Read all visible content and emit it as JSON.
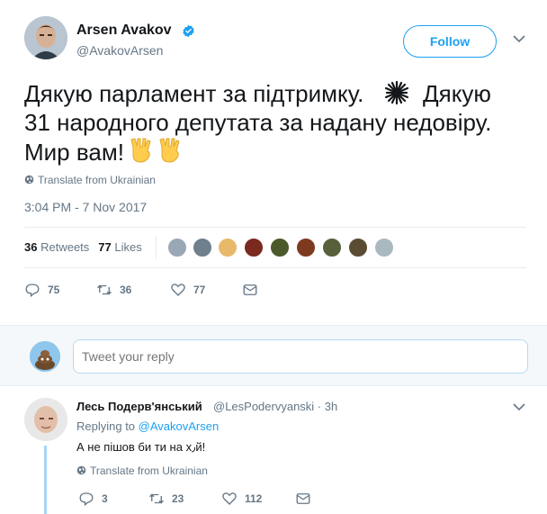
{
  "author": {
    "name": "Arsen Avakov",
    "handle": "@AvakovArsen",
    "verified": true
  },
  "follow_label": "Follow",
  "tweet": {
    "lines": [
      "Дякую парламент за підтримку. ",
      "31 народного депутата за надану недовіру.",
      "Мир вам!"
    ],
    "line1_tail": "  Дякую",
    "emoji": [
      "sparkle-icon",
      "vulcan-salute-icon",
      "vulcan-salute-icon"
    ],
    "translate_label": "Translate from Ukrainian",
    "timestamp": "3:04 PM - 7 Nov 2017"
  },
  "stats": {
    "retweets_count": "36",
    "retweets_label": "Retweets",
    "likes_count": "77",
    "likes_label": "Likes"
  },
  "actions": {
    "replies": "75",
    "retweets": "36",
    "likes": "77"
  },
  "liker_colors": [
    "#9aa7b5",
    "#6f7f8c",
    "#e8b96a",
    "#7a2a1f",
    "#4a5a2a",
    "#7d3a1e",
    "#57603a",
    "#5a4b33",
    "#aab8c2"
  ],
  "reply_box": {
    "placeholder": "Tweet your reply"
  },
  "reply": {
    "name": "Лесь Подерв'янський",
    "handle": "@LesPodervyanski · 3h",
    "replying_prefix": "Replying to",
    "replying_mention": "@AvakovArsen",
    "text": "А не пішов би ти на х٫й!",
    "translate_label": "Translate from Ukrainian",
    "actions": {
      "replies": "3",
      "retweets": "23",
      "likes": "112"
    }
  },
  "colors": {
    "accent": "#1da1f2",
    "muted": "#657786",
    "text": "#14171a",
    "like_red": "#e0245e"
  }
}
